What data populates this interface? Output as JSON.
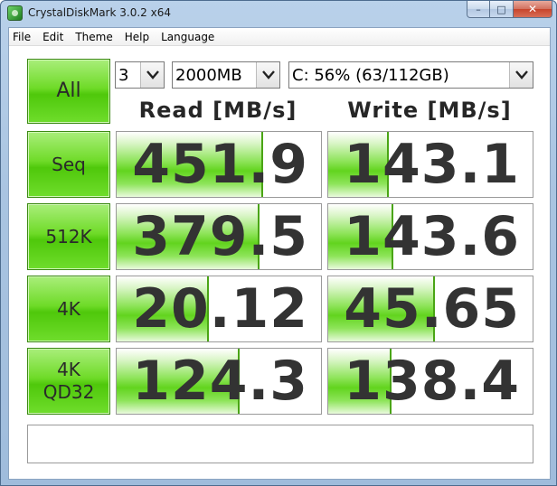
{
  "window": {
    "title": "CrystalDiskMark 3.0.2 x64",
    "minimize": "–",
    "maximize": "□",
    "close": "✕"
  },
  "menu": [
    "File",
    "Edit",
    "Theme",
    "Help",
    "Language"
  ],
  "controls": {
    "all_label": "All",
    "count": "3",
    "size": "2000MB",
    "drive": "C: 56% (63/112GB)"
  },
  "headers": {
    "read": "Read [MB/s]",
    "write": "Write [MB/s]"
  },
  "tests": [
    {
      "label": "Seq",
      "label2": "",
      "read": "451.9",
      "write": "143.1",
      "read_level": 0.715,
      "write_level": 0.295
    },
    {
      "label": "512K",
      "label2": "",
      "read": "379.5",
      "write": "143.6",
      "read_level": 0.7,
      "write_level": 0.32
    },
    {
      "label": "4K",
      "label2": "",
      "read": "20.12",
      "write": "45.65",
      "read_level": 0.45,
      "write_level": 0.52
    },
    {
      "label": "4K",
      "label2": "QD32",
      "read": "124.3",
      "write": "138.4",
      "read_level": 0.6,
      "write_level": 0.31
    }
  ],
  "comment": "",
  "colors": {
    "accent_green": "#62d41e",
    "value_text": "#333333"
  }
}
